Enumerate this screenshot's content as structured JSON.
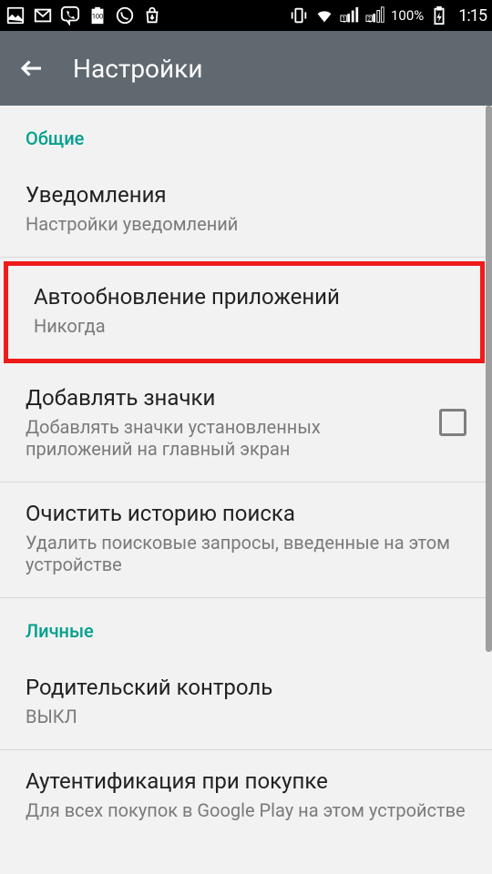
{
  "statusBar": {
    "batteryPct": "100%",
    "time": "1:15"
  },
  "appBar": {
    "title": "Настройки"
  },
  "sections": {
    "general": {
      "header": "Общие",
      "items": {
        "notifications": {
          "title": "Уведомления",
          "sub": "Настройки уведомлений"
        },
        "autoUpdate": {
          "title": "Автообновление приложений",
          "sub": "Никогда"
        },
        "addIcons": {
          "title": "Добавлять значки",
          "sub": "Добавлять значки установленных приложений на главный экран"
        },
        "clearHistory": {
          "title": "Очистить историю поиска",
          "sub": "Удалить поисковые запросы, введенные на этом устройстве"
        }
      }
    },
    "personal": {
      "header": "Личные",
      "items": {
        "parental": {
          "title": "Родительский контроль",
          "sub": "ВЫКЛ"
        },
        "auth": {
          "title": "Аутентификация при покупке",
          "sub": "Для всех покупок в Google Play на этом устройстве"
        }
      }
    }
  }
}
